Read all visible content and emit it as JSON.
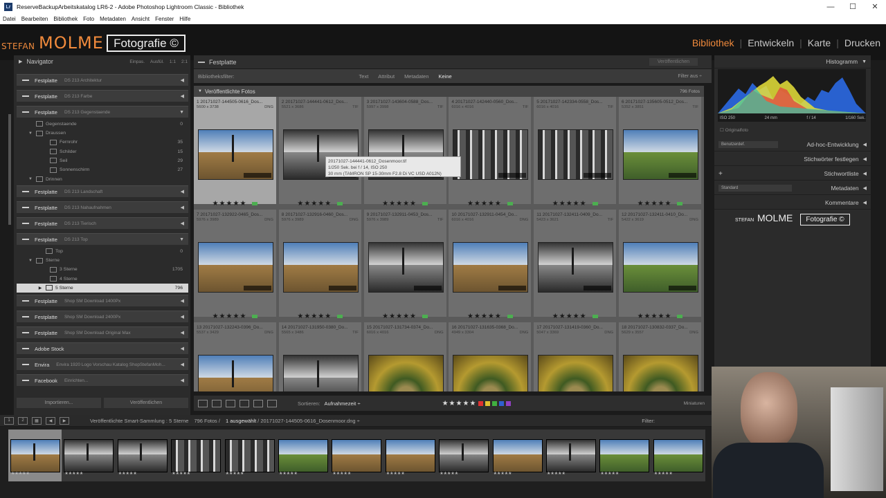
{
  "window": {
    "app_icon": "Lr",
    "title": "ReserveBackupArbeitskatalog LR6-2 - Adobe Photoshop Lightroom Classic - Bibliothek",
    "controls": [
      "—",
      "☐",
      "✕"
    ]
  },
  "menubar": [
    "Datei",
    "Bearbeiten",
    "Bibliothek",
    "Foto",
    "Metadaten",
    "Ansicht",
    "Fenster",
    "Hilfe"
  ],
  "identity": {
    "stefan": "STEFAN",
    "molme": "MOLME",
    "fotografie": "Fotografie ©"
  },
  "modules": {
    "items": [
      "Bibliothek",
      "Entwickeln",
      "Karte",
      "Drucken"
    ],
    "active": "Bibliothek"
  },
  "navigator": {
    "title": "Navigator",
    "options": [
      "Einpas.",
      "Ausfül.",
      "1:1",
      "2:1"
    ]
  },
  "services": [
    {
      "label": "Festplatte",
      "sub": "DS 213 Architektur"
    },
    {
      "label": "Festplatte",
      "sub": "DS 213 Farbe"
    },
    {
      "label": "Festplatte",
      "sub": "DS 213 Gegenstaende"
    },
    {
      "label": "Festplatte",
      "sub": "DS 213 Landschaft"
    },
    {
      "label": "Festplatte",
      "sub": "DS 213 Nahaufnahmen"
    },
    {
      "label": "Festplatte",
      "sub": "DS 213 Tierisch"
    },
    {
      "label": "Festplatte",
      "sub": "DS 213 Top"
    },
    {
      "label": "Festplatte",
      "sub": "Shop SM Download 1400Px"
    },
    {
      "label": "Festplatte",
      "sub": "Shop SM Download 2400Px"
    },
    {
      "label": "Festplatte",
      "sub": "Shop SM Download Original Max"
    },
    {
      "label": "Adobe Stock",
      "sub": ""
    },
    {
      "label": "Envira",
      "sub": "Envira 1920 Logo Vorschau Katalog ShopStefanMoh..."
    },
    {
      "label": "Facebook",
      "sub": "Einrichten..."
    }
  ],
  "collections_gegen": [
    {
      "label": "Gegenstaende",
      "count": "0"
    },
    {
      "label": "Draussen",
      "count": ""
    },
    {
      "label": "Fernrohr",
      "count": "35"
    },
    {
      "label": "Schilder",
      "count": "15"
    },
    {
      "label": "Seil",
      "count": "29"
    },
    {
      "label": "Sonnenschirm",
      "count": "27"
    },
    {
      "label": "Drinnen",
      "count": ""
    }
  ],
  "collections_top": [
    {
      "label": "Top",
      "count": "0"
    },
    {
      "label": "Sterne",
      "count": ""
    },
    {
      "label": "3 Sterne",
      "count": "1705"
    },
    {
      "label": "4 Sterne",
      "count": ""
    },
    {
      "label": "5 Sterne",
      "count": "796"
    }
  ],
  "left_buttons": [
    "Importieren...",
    "Veröffentlichen"
  ],
  "center": {
    "title": "Festplatte",
    "publish": "Veröffentlichen",
    "filter_label": "Bibliotheksfilter:",
    "filters": [
      "Text",
      "Attribut",
      "Metadaten",
      "Keine"
    ],
    "filter_active": "Keine",
    "filter_off": "Filter aus ÷",
    "group_title": "Veröffentlichte Fotos",
    "group_count": "796 Fotos"
  },
  "cells": [
    {
      "num": "1",
      "name": "20171027-144505-0616_Dos...",
      "dim": "5600 x 3738",
      "ext": "DNG",
      "kind": "tree"
    },
    {
      "num": "2",
      "name": "20171027-144441-0612_Dos...",
      "dim": "5521 x 3686",
      "ext": "TIF",
      "kind": "bw"
    },
    {
      "num": "3",
      "name": "20171027-143604-0588_Dos...",
      "dim": "5997 x 3998",
      "ext": "TIF",
      "kind": "bw"
    },
    {
      "num": "4",
      "name": "20171027-142440-0560_Dos...",
      "dim": "6016 x 4016",
      "ext": "TIF",
      "kind": "forest"
    },
    {
      "num": "5",
      "name": "20171027-142334-0558_Dos...",
      "dim": "6016 x 4016",
      "ext": "TIF",
      "kind": "forest"
    },
    {
      "num": "6",
      "name": "20171027-135605-0512_Dos...",
      "dim": "5352 x 3851",
      "ext": "TIF",
      "kind": "marsh"
    },
    {
      "num": "7",
      "name": "20171027-132922-0465_Dos...",
      "dim": "5976 x 3989",
      "ext": "DNG",
      "kind": "water"
    },
    {
      "num": "8",
      "name": "20171027-132916-0460_Dos...",
      "dim": "5976 x 3989",
      "ext": "DNG",
      "kind": "water"
    },
    {
      "num": "9",
      "name": "20171027-132911-0453_Dos...",
      "dim": "5976 x 3989",
      "ext": "TIF",
      "kind": "bw"
    },
    {
      "num": "10",
      "name": "20171027-132911-0454_Do...",
      "dim": "6016 x 4016",
      "ext": "DNG",
      "kind": "water"
    },
    {
      "num": "11",
      "name": "20171027-132411-0409_Do...",
      "dim": "5423 x 3621",
      "ext": "TIF",
      "kind": "bw"
    },
    {
      "num": "12",
      "name": "20171027-132411-0410_Do...",
      "dim": "5422 x 3619",
      "ext": "DNG",
      "kind": "marsh"
    },
    {
      "num": "13",
      "name": "20171027-132243-0396_Do...",
      "dim": "5537 x 3429",
      "ext": "DNG",
      "kind": "tree"
    },
    {
      "num": "14",
      "name": "20171027-131950-0380_Do...",
      "dim": "5565 x 3486",
      "ext": "TIF",
      "kind": "bw"
    },
    {
      "num": "15",
      "name": "20171027-131734-0374_Do...",
      "dim": "6016 x 4016",
      "ext": "DNG",
      "kind": "autumn"
    },
    {
      "num": "16",
      "name": "20171027-131635-0368_Do...",
      "dim": "4949 x 3304",
      "ext": "DNG",
      "kind": "autumn"
    },
    {
      "num": "17",
      "name": "20171027-131419-0360_Do...",
      "dim": "5047 x 3369",
      "ext": "DNG",
      "kind": "autumn"
    },
    {
      "num": "18",
      "name": "20171027-130832-0337_Do...",
      "dim": "5629 x 3557",
      "ext": "DNG",
      "kind": "autumn"
    }
  ],
  "rating": "★★★★★",
  "tooltip": {
    "line1": "20171027-144441-0612_Dosenmoor.tif",
    "line2": "1/250 Sek. bei f / 14, ISO 250",
    "line3": "30 mm (TAMRON SP 15-30mm F2.8 Di VC USD A012N)"
  },
  "toolbar": {
    "sort_label": "Sortieren:",
    "sort_value": "Aufnahmezeit ÷",
    "stars": "★★★★★",
    "thumbs_label": "Miniaturen",
    "color_labels": [
      "#e03030",
      "#e0c030",
      "#40b040",
      "#3060d0",
      "#9040c0"
    ]
  },
  "right": {
    "histogram": "Histogramm",
    "iso": "ISO 250",
    "focal": "24 mm",
    "aperture": "f / 14",
    "shutter": "1/160 Sek.",
    "original": "Originalfoto",
    "preset": "Benutzerdef.",
    "quick": "Ad-hoc-Entwicklung",
    "keywords": "Stichwörter festlegen",
    "keywordlist": "Stichwortliste",
    "standard": "Standard",
    "metadata": "Metadaten",
    "comments": "Kommentare",
    "plus": "+"
  },
  "filmstrip": {
    "path": "Veröffentlichte Smart-Sammlung : 5 Sterne",
    "count": "796 Fotos /",
    "selected": "1 ausgewählt",
    "filename": "/ 20171027-144505-0616_Dosenmoor.dng ÷",
    "filter": "Filter:",
    "page1": "1",
    "page2": "2",
    "kinds": [
      "tree",
      "bw",
      "bw",
      "forest",
      "forest",
      "marsh",
      "water",
      "water",
      "bw",
      "water",
      "bw",
      "marsh",
      "marsh"
    ]
  }
}
